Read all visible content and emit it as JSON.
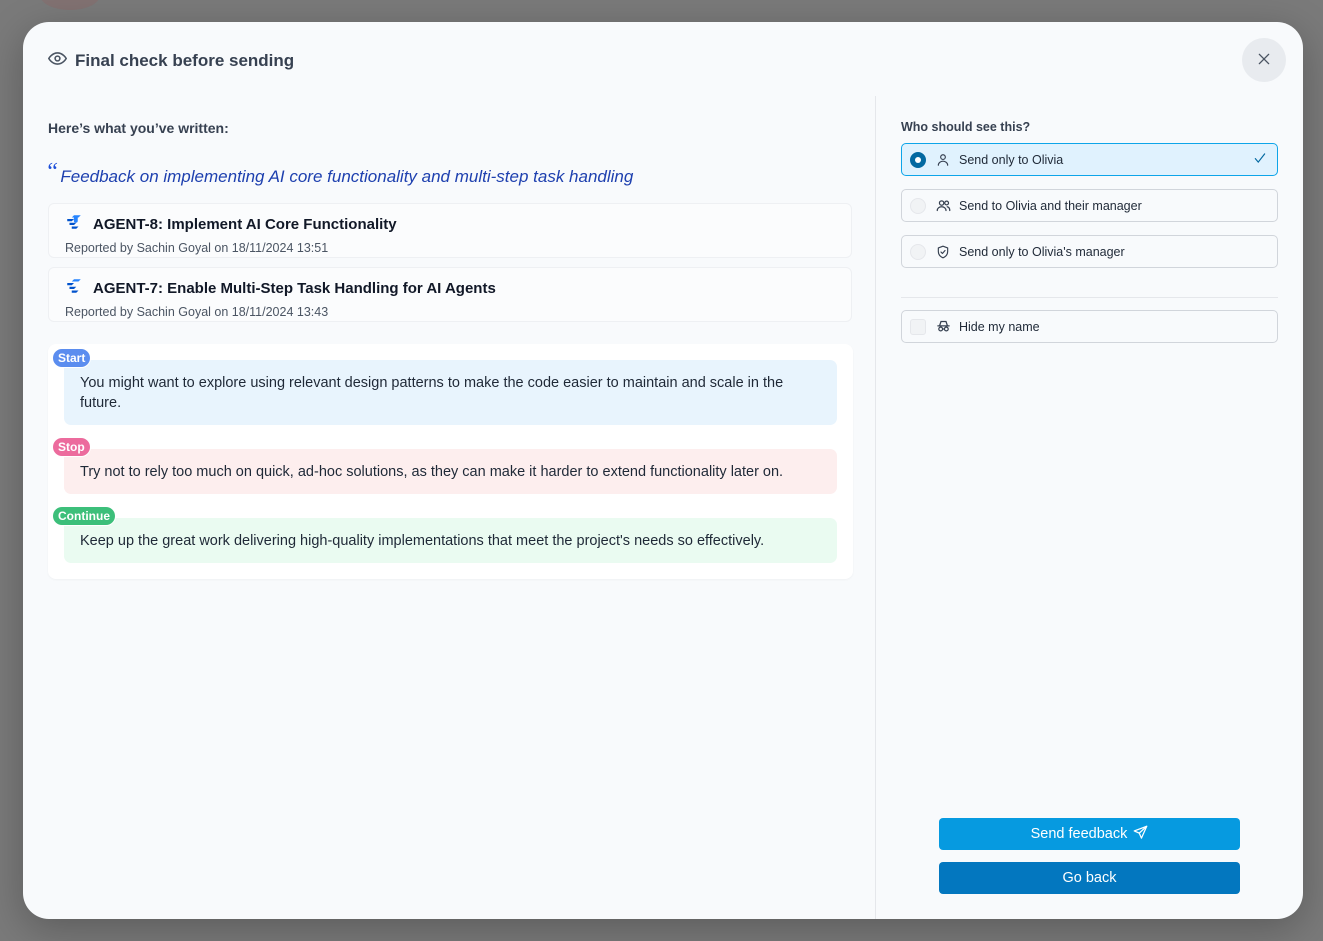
{
  "modal": {
    "title": "Final check before sending",
    "title_icon": "eye-icon",
    "close_icon": "close-icon"
  },
  "review": {
    "written_label": "Here’s what you’ve written:",
    "quote_mark": "“",
    "feedback_title": "Feedback on implementing AI core functionality and multi-step task handling",
    "tickets": [
      {
        "icon": "jira-icon",
        "title": "AGENT-8: Implement AI Core Functionality",
        "meta": "Reported by Sachin Goyal on 18/11/2024 13:51"
      },
      {
        "icon": "jira-icon",
        "title": "AGENT-7: Enable Multi-Step Task Handling for AI Agents",
        "meta": "Reported by Sachin Goyal on 18/11/2024 13:43"
      }
    ],
    "feedback": {
      "start": {
        "tag": "Start",
        "text": "You might want to explore using relevant design patterns to make the code easier to maintain and scale in the future."
      },
      "stop": {
        "tag": "Stop",
        "text": "Try not to rely too much on quick, ad-hoc solutions, as they can make it harder to extend functionality later on."
      },
      "continue": {
        "tag": "Continue",
        "text": "Keep up the great work delivering high-quality implementations that meet the project's needs so effectively."
      }
    }
  },
  "audience": {
    "label": "Who should see this?",
    "options": [
      {
        "label": "Send only to Olivia",
        "icon": "user-icon",
        "selected": true
      },
      {
        "label": "Send to Olivia and their manager",
        "icon": "users-icon",
        "selected": false
      },
      {
        "label": "Send only to Olivia's manager",
        "icon": "shield-icon",
        "selected": false
      }
    ],
    "hide_name": {
      "label": "Hide my name",
      "icon": "incognito-icon",
      "checked": false
    }
  },
  "actions": {
    "send_label": "Send feedback",
    "send_icon": "send-icon",
    "back_label": "Go back"
  },
  "colors": {
    "primary": "#069ae0",
    "secondary": "#0377bf",
    "start": "#5b8def",
    "stop": "#ec6b9d",
    "continue": "#3cbf7a"
  }
}
